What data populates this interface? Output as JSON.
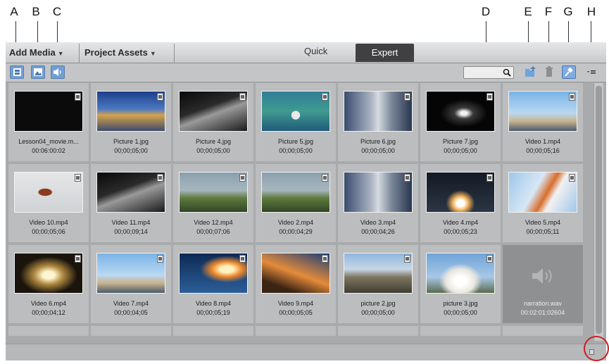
{
  "callouts": [
    "A",
    "B",
    "C",
    "D",
    "E",
    "F",
    "G",
    "H"
  ],
  "topbar": {
    "add_media": "Add Media",
    "project_assets": "Project Assets",
    "mode_quick": "Quick",
    "mode_expert": "Expert",
    "active_mode": "Expert"
  },
  "toolbar": {
    "filters": [
      "video-filter",
      "image-filter",
      "audio-filter"
    ],
    "search_value": ""
  },
  "colors": {
    "accent": "#6f9fd6",
    "active_tab": "#404042",
    "callout_ring": "#cc1e22"
  },
  "assets": [
    {
      "name": "Lesson04_movie.m...",
      "duration": "00:06:00:02",
      "type": "video",
      "thumb": "black"
    },
    {
      "name": "Picture 1.jpg",
      "duration": "00;00;05;00",
      "type": "image",
      "thumb": "cockpit"
    },
    {
      "name": "Picture 4.jpg",
      "duration": "00;00;05;00",
      "type": "image",
      "thumb": "station"
    },
    {
      "name": "Picture 5.jpg",
      "duration": "00;00;05;00",
      "type": "image",
      "thumb": "orbit"
    },
    {
      "name": "Picture 6.jpg",
      "duration": "00;00;05;00",
      "type": "image",
      "thumb": "pad"
    },
    {
      "name": "Picture 7.jpg",
      "duration": "00;00;05;00",
      "type": "image",
      "thumb": "night"
    },
    {
      "name": "Video 1.mp4",
      "duration": "00;00;05;16",
      "type": "video",
      "thumb": "launch-sky"
    },
    {
      "name": "Video 10.mp4",
      "duration": "00;00;05;06",
      "type": "video",
      "thumb": "debris"
    },
    {
      "name": "Video 11.mp4",
      "duration": "00;00;09;14",
      "type": "video",
      "thumb": "station"
    },
    {
      "name": "Video 12.mp4",
      "duration": "00;00;07;06",
      "type": "video",
      "thumb": "landing"
    },
    {
      "name": "Video 2.mp4",
      "duration": "00;00;04;29",
      "type": "video",
      "thumb": "landing"
    },
    {
      "name": "Video 3.mp4",
      "duration": "00;00;04;26",
      "type": "video",
      "thumb": "pad"
    },
    {
      "name": "Video 4.mp4",
      "duration": "00;00;05;23",
      "type": "video",
      "thumb": "liftoff"
    },
    {
      "name": "Video 5.mp4",
      "duration": "00;00;05;11",
      "type": "video",
      "thumb": "boosters"
    },
    {
      "name": "Video 6.mp4",
      "duration": "00;00;04;12",
      "type": "video",
      "thumb": "night-pad"
    },
    {
      "name": "Video 7.mp4",
      "duration": "00;00;04;05",
      "type": "video",
      "thumb": "launch-sky"
    },
    {
      "name": "Video 8.mp4",
      "duration": "00;00;05;19",
      "type": "video",
      "thumb": "flame"
    },
    {
      "name": "Video 9.mp4",
      "duration": "00;00;05;05",
      "type": "video",
      "thumb": "sunset"
    },
    {
      "name": "picture 2.jpg",
      "duration": "00;00;05;00",
      "type": "image",
      "thumb": "pad-day"
    },
    {
      "name": "picture 3.jpg",
      "duration": "00;00;05;00",
      "type": "image",
      "thumb": "liftoff-day"
    },
    {
      "name": "narration.wav",
      "duration": "00:02:01:02604",
      "type": "audio",
      "thumb": "speaker",
      "selected": true
    }
  ]
}
